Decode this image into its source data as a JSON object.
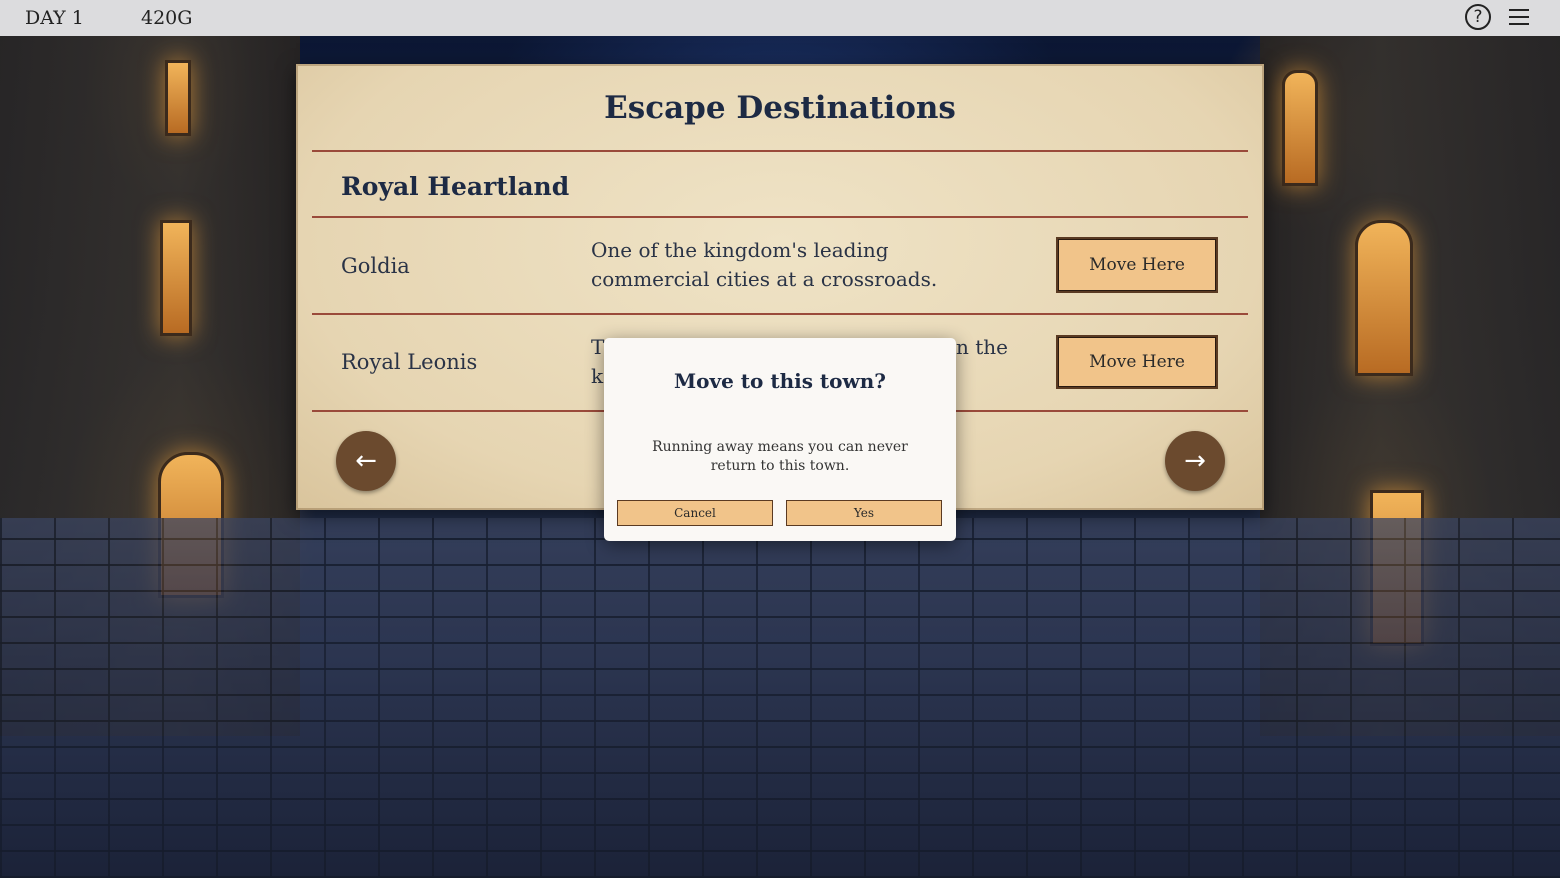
{
  "topbar": {
    "day": "DAY 1",
    "gold": "420G",
    "help_icon": "?",
    "menu_icon": "hamburger-menu-icon"
  },
  "panel": {
    "title": "Escape Destinations",
    "region": "Royal Heartland",
    "towns": [
      {
        "name": "Goldia",
        "description": "One of the kingdom's leading commercial cities at a crossroads.",
        "button": "Move Here"
      },
      {
        "name": "Royal Leonis",
        "description_visible_start": "T",
        "description_visible_line2_start": "k",
        "description_visible_end": "n the",
        "button": "Move Here"
      }
    ],
    "prev_icon": "←",
    "next_icon": "→"
  },
  "modal": {
    "title": "Move to this town?",
    "text": "Running away means you can never return to this town.",
    "cancel": "Cancel",
    "yes": "Yes"
  },
  "colors": {
    "topbar_bg": "#dcdcde",
    "parchment": "#e6d5b2",
    "rule": "#9a4a3a",
    "title_text": "#1d2a44",
    "button_bg": "#f1c48a",
    "nav_button_bg": "#6b4a2e"
  }
}
